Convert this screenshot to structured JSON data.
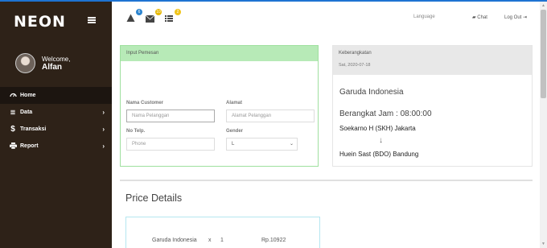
{
  "brand": "NEON",
  "profile": {
    "welcome": "Welcome,",
    "name": "Alfan"
  },
  "nav": [
    {
      "label": "Home",
      "icon": "dashboard-icon"
    },
    {
      "label": "Data",
      "icon": "list-icon"
    },
    {
      "label": "Transaksi",
      "icon": "dollar-icon"
    },
    {
      "label": "Report",
      "icon": "printer-icon"
    }
  ],
  "topbar": {
    "badges": [
      "6",
      "10",
      "2"
    ],
    "language": "Language",
    "chat": "Chat",
    "logout": "Log Out"
  },
  "input_card": {
    "title": "Input Pemesan",
    "customer_label": "Nama Customer",
    "customer_placeholder": "Nama Pelanggan",
    "alamat_label": "Alamat",
    "alamat_placeholder": "Alamat Pelanggan",
    "telp_label": "No Telp.",
    "telp_placeholder": "Phone",
    "gender_label": "Gender",
    "gender_value": "L"
  },
  "departure": {
    "title": "Keberangkatan",
    "date": "Sat, 2020-07-18",
    "airline": "Garuda Indonesia",
    "time": "Berangkat Jam : 08:00:00",
    "from": "Soekarno H (SKH) Jakarta",
    "arrow": "↓",
    "to": "Huein Sast (BDO) Bandung"
  },
  "price": {
    "title": "Price Details",
    "airline": "Garuda Indonesia",
    "times": "x",
    "qty": "1",
    "amount": "Rp.10922"
  },
  "colors": {
    "sidebar": "#2e2218",
    "input_head": "#b7eab7",
    "accent": "#1e73d2"
  }
}
